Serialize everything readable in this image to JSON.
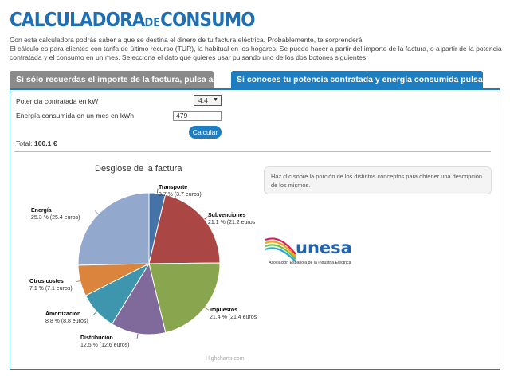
{
  "header": {
    "title_a": "CALCULADORA",
    "title_b": "DE",
    "title_c": "CONSUMO"
  },
  "intro": {
    "line1": "Con esta calculadora podrás saber a que se destina el dinero de tu factura eléctrica. Probablemente, te sorprenderá.",
    "line2": "El cálculo es para clientes con tarifa de último recurso (TUR), la habitual en los hogares. Se puede hacer a partir del importe de la factura, o a partir de la potencia contratada y el consumo en un mes. Selecciona el dato que quieres usar pulsando uno de los dos botones siguientes:"
  },
  "tabs": {
    "importe": "Si sólo recuerdas el importe de la factura, pulsa aquí.",
    "potencia": "Si conoces tu potencia contratada y energía consumida pulsa aquí."
  },
  "form": {
    "potencia_label": "Potencia contratada en kW",
    "potencia_value": "4.4",
    "energia_label": "Energía consumida en un mes en kWh",
    "energia_value": "479",
    "calcular": "Calcular",
    "total_label": "Total:",
    "total_value": "100.1 €"
  },
  "chart_title": "Desglose de la factura",
  "hint": "Haz clic sobre la porción de los distintos conceptos para obtener una descripción de los mismos.",
  "logo": {
    "word": "unesa",
    "sub": "Asociación Española de la Industria Eléctrica"
  },
  "credit": "Highcharts.com",
  "chart_data": {
    "type": "pie",
    "title": "Desglose de la factura",
    "slices": [
      {
        "name": "Transporte",
        "pct": "3.7 %",
        "amount": "(3.7 euros)",
        "value": 3.7,
        "color": "#4572A7"
      },
      {
        "name": "Subvenciones",
        "pct": "21.1 %",
        "amount": "(21.2 euros",
        "value": 21.1,
        "color": "#AA4643"
      },
      {
        "name": "Impuestos",
        "pct": "21.4 %",
        "amount": "(21.4 euros",
        "value": 21.4,
        "color": "#89A54E"
      },
      {
        "name": "Distribucion",
        "pct": "12.5 %",
        "amount": "(12.6 euros)",
        "value": 12.5,
        "color": "#80699B"
      },
      {
        "name": "Amortizacion",
        "pct": "8.8 %",
        "amount": "(8.8 euros)",
        "value": 8.8,
        "color": "#3D96AE"
      },
      {
        "name": "Otros costes",
        "pct": "7.1 %",
        "amount": "(7.1 euros)",
        "value": 7.1,
        "color": "#DB843D"
      },
      {
        "name": "Energía",
        "pct": "25.3 %",
        "amount": "(25.4 euros)",
        "value": 25.3,
        "color": "#92A8CD"
      }
    ]
  }
}
